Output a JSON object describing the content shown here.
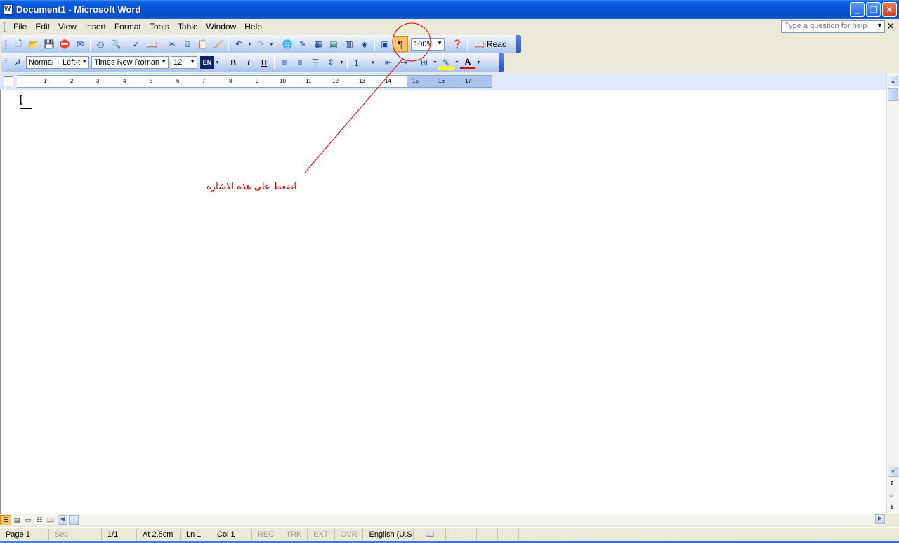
{
  "window": {
    "title": "Document1 - Microsoft Word"
  },
  "menu": {
    "items": [
      "File",
      "Edit",
      "View",
      "Insert",
      "Format",
      "Tools",
      "Table",
      "Window",
      "Help"
    ]
  },
  "help": {
    "placeholder": "Type a question for help"
  },
  "standard_toolbar": {
    "zoom": "100%",
    "read_label": "Read",
    "show_hide_glyph": "¶"
  },
  "formatting_toolbar": {
    "style": "Normal + Left-t",
    "font": "Times New Roman",
    "size": "12",
    "language_badge": "EN",
    "bold": "B",
    "italic": "I",
    "underline": "U",
    "font_color_glyph": "A"
  },
  "ruler": {
    "numbers": [
      "1",
      "2",
      "3",
      "4",
      "5",
      "6",
      "7",
      "8",
      "9",
      "10",
      "11",
      "12",
      "13",
      "14",
      "15",
      "16",
      "17"
    ]
  },
  "document": {
    "annotation": "اضغط على هذه الاشاره",
    "annotation_color": "#d00000"
  },
  "statusbar": {
    "page": "Page 1",
    "sec": "Sec",
    "pages": "1/1",
    "at": "At 2.5cm",
    "ln": "Ln 1",
    "col": "Col 1",
    "rec": "REC",
    "trk": "TRK",
    "ext": "EXT",
    "ovr": "OVR",
    "language": "English (U.S"
  }
}
